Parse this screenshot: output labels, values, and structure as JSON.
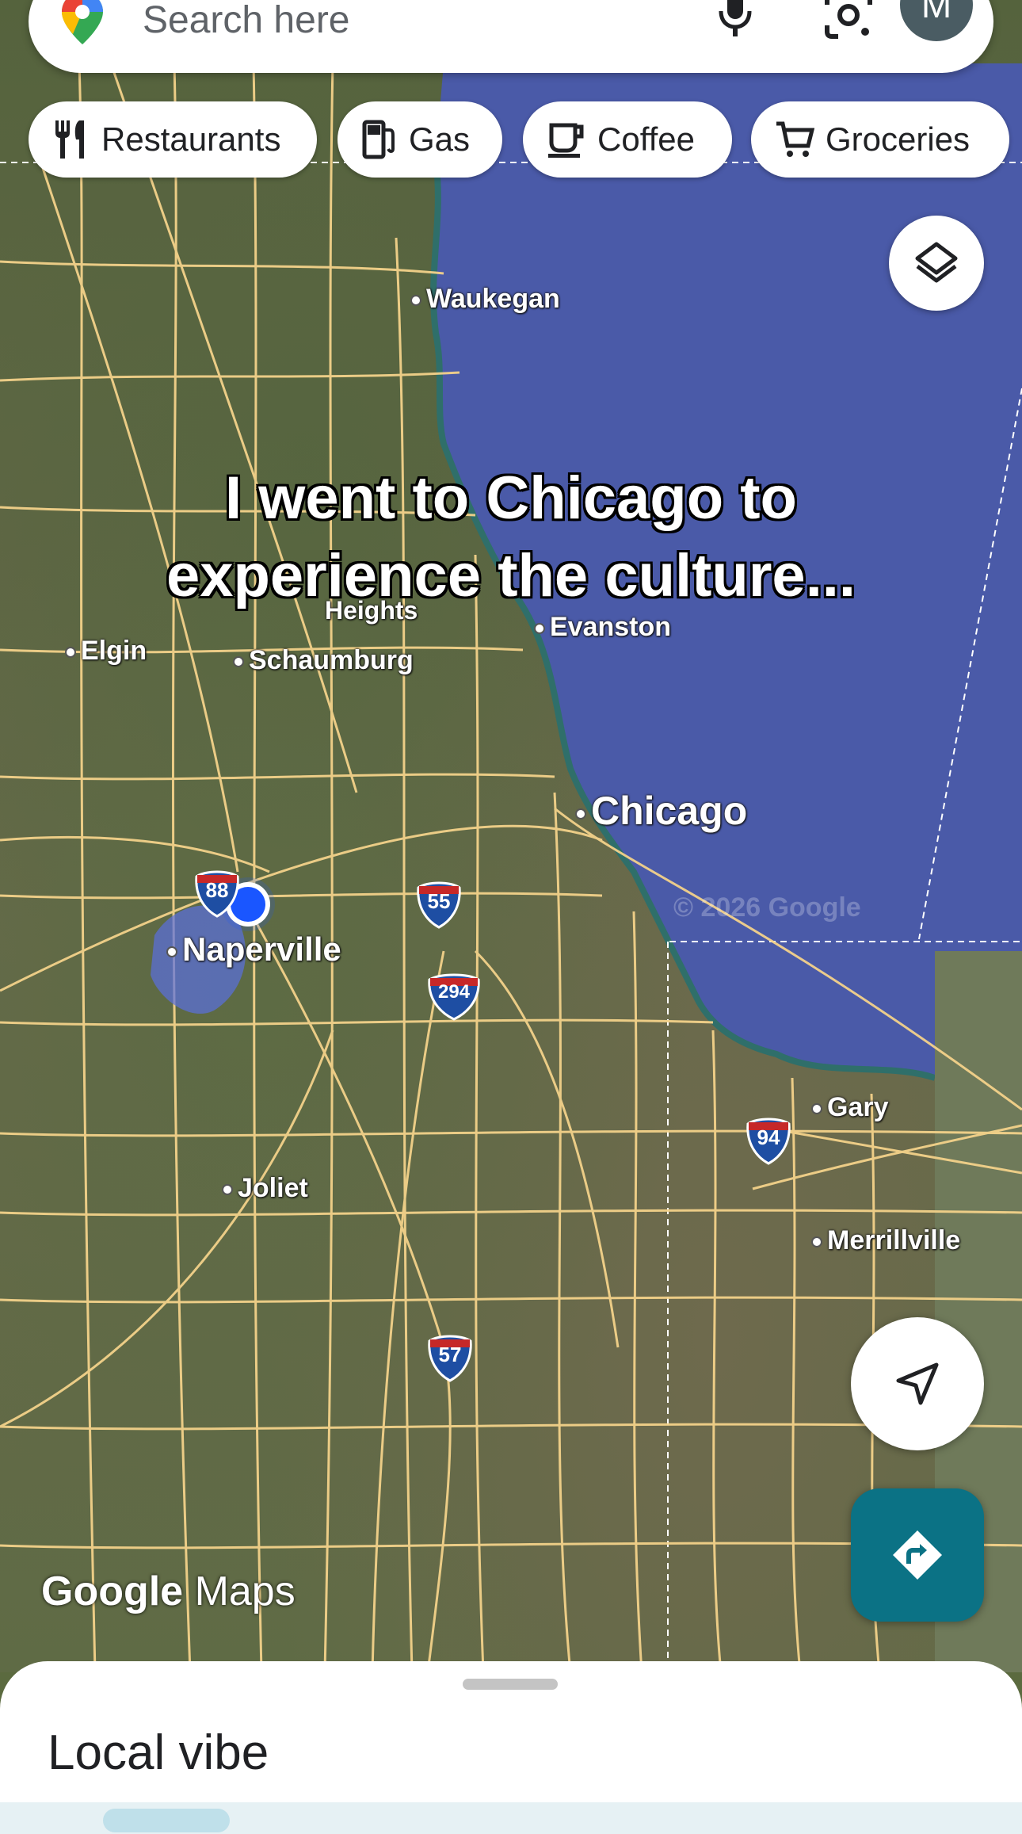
{
  "search": {
    "placeholder": "Search here",
    "avatar_letter": "M"
  },
  "chips": [
    "Restaurants",
    "Gas",
    "Coffee",
    "Groceries"
  ],
  "caption": {
    "line1": "I went to Chicago to",
    "line2": "experience the culture..."
  },
  "places": {
    "waukegan": "Waukegan",
    "heights": "Heights",
    "evanston": "Evanston",
    "elgin": "Elgin",
    "schaumburg": "Schaumburg",
    "chicago": "Chicago",
    "naperville": "Naperville",
    "gary": "Gary",
    "joliet": "Joliet",
    "merrillville": "Merrillville"
  },
  "highways": {
    "i88": "88",
    "i55": "55",
    "i294": "294",
    "i94": "94",
    "i57": "57"
  },
  "copyright": "© 2026 Google",
  "watermark": {
    "google": "Google",
    "maps": "Maps"
  },
  "sheet": {
    "title": "Local vibe"
  },
  "colors": {
    "lake": "#4a5aa8",
    "roads": "#f3d28a",
    "directions_button": "#0b7285",
    "location_dot": "#1a56ff"
  },
  "icons": [
    "maps-pin-icon",
    "mic-icon",
    "lens-icon",
    "fork-knife-icon",
    "gas-pump-icon",
    "coffee-cup-icon",
    "cart-icon",
    "layers-icon",
    "navigation-arrow-icon",
    "directions-icon"
  ]
}
